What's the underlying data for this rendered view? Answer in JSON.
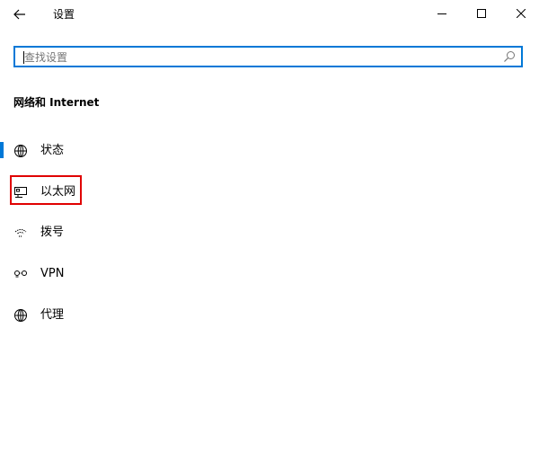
{
  "titlebar": {
    "title": "设置",
    "icons": {
      "back": "back-arrow-icon",
      "minimize": "minimize-icon",
      "maximize": "maximize-icon",
      "close": "close-icon"
    }
  },
  "search": {
    "value": "",
    "placeholder": "查找设置",
    "icon": "search-icon",
    "accent_color": "#0078d7"
  },
  "section": {
    "title": "网络和 Internet"
  },
  "nav": {
    "items": [
      {
        "label": "状态",
        "icon": "globe-status-icon",
        "selected": true
      },
      {
        "label": "以太网",
        "icon": "ethernet-monitor-icon",
        "selected": false,
        "highlighted": true
      },
      {
        "label": "拨号",
        "icon": "dialup-icon",
        "selected": false
      },
      {
        "label": "VPN",
        "icon": "vpn-icon",
        "selected": false
      },
      {
        "label": "代理",
        "icon": "globe-proxy-icon",
        "selected": false
      }
    ],
    "indicator_color": "#0078d7",
    "highlight_color": "#e00000"
  }
}
